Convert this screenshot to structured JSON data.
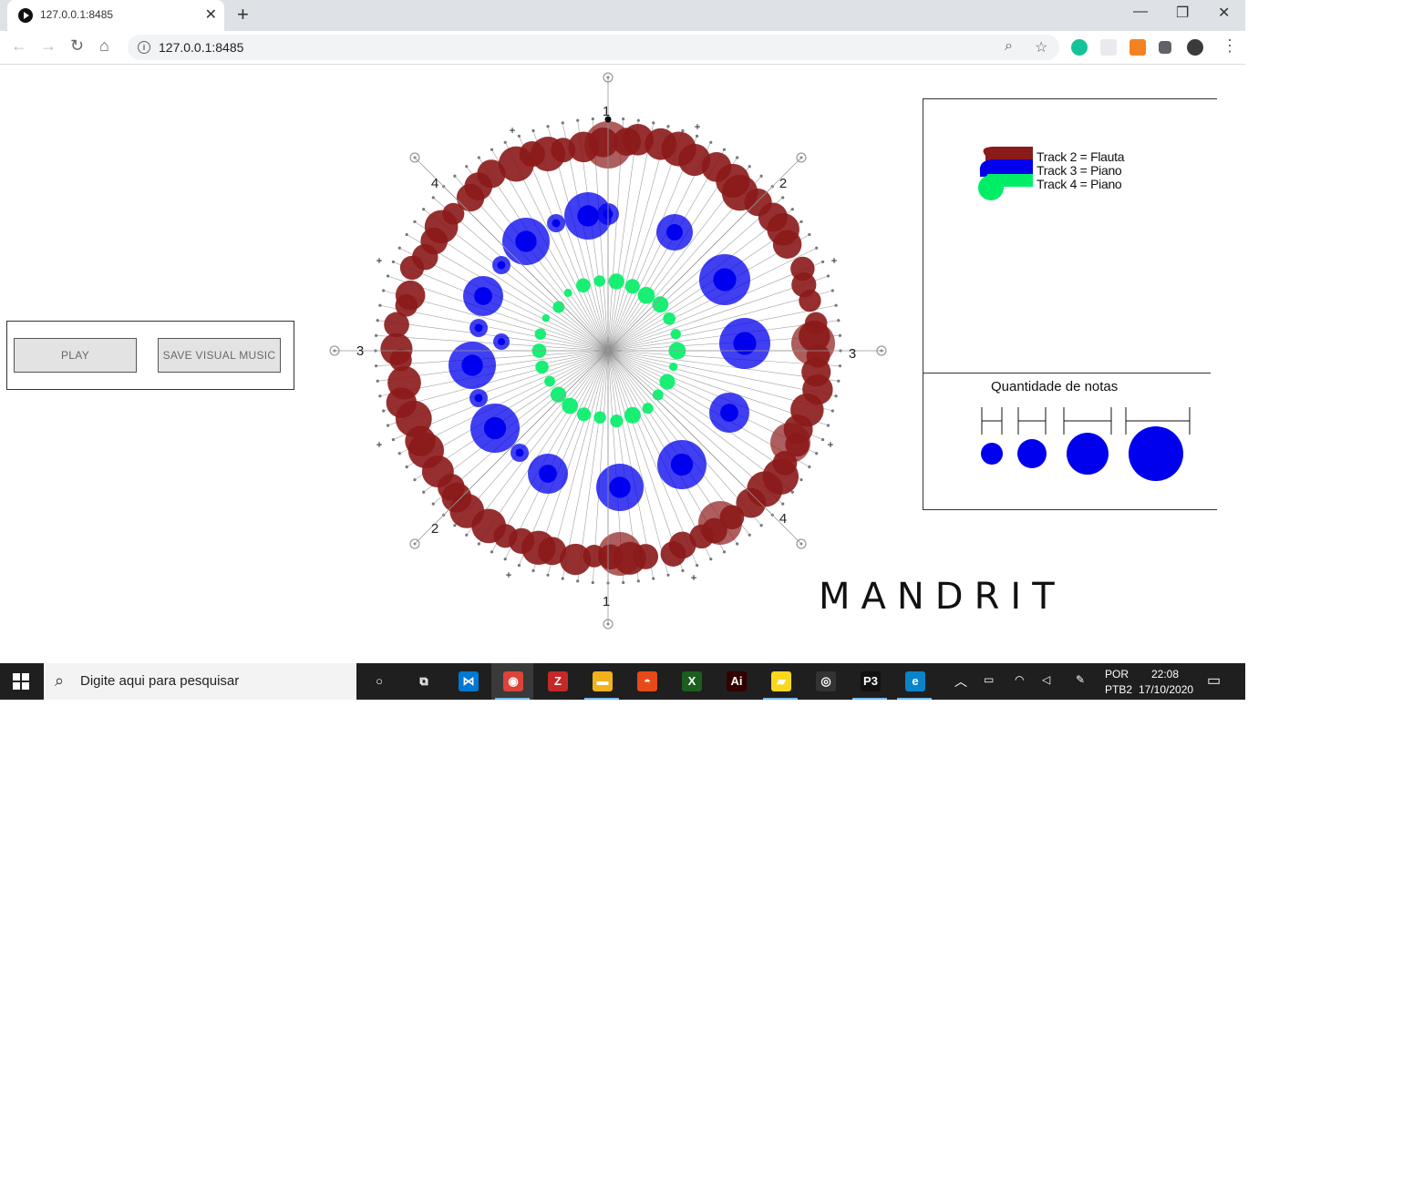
{
  "browser": {
    "tab_title": "127.0.0.1:8485",
    "url": "127.0.0.1:8485",
    "close_glyph": "✕",
    "new_tab_glyph": "+",
    "back_glyph": "←",
    "forward_glyph": "→",
    "reload_glyph": "↻",
    "home_glyph": "⌂",
    "zoom_glyph": "⌕",
    "star_glyph": "☆",
    "menu_glyph": "⋮",
    "minimize_glyph": "—",
    "restore_glyph": "❐",
    "close_window_glyph": "✕"
  },
  "app": {
    "play_label": "PLAY",
    "save_label": "SAVE VISUAL MUSIC",
    "brand": "MANDRIT",
    "legend": {
      "tracks": [
        {
          "label": "Track 2 = Flauta",
          "color": "#8b1a1a"
        },
        {
          "label": "Track 3 = Piano",
          "color": "#0000ee"
        },
        {
          "label": "Track 4 = Piano",
          "color": "#00ee66"
        }
      ],
      "quantity_title": "Quantidade de notas",
      "size_color": "#0000ee"
    },
    "mandala": {
      "axis_labels": {
        "top": "1",
        "bottom": "1",
        "left": "3",
        "right": "3",
        "upper_left": "4",
        "upper_right": "2",
        "lower_left": "2",
        "lower_right": "4"
      },
      "plus_glyph": "+",
      "colors": {
        "outer": "#8b1a1a",
        "middle": "#0000ee",
        "inner": "#00ee66",
        "lines": "#888888"
      }
    }
  },
  "taskbar": {
    "search_placeholder": "Digite aqui para pesquisar",
    "apps": [
      {
        "name": "cortana",
        "glyph": "○"
      },
      {
        "name": "task-view",
        "glyph": "⧉"
      },
      {
        "name": "vscode",
        "glyph": "⋈"
      },
      {
        "name": "chrome",
        "glyph": "◉"
      },
      {
        "name": "zotero",
        "glyph": "Z"
      },
      {
        "name": "file-explorer",
        "glyph": "▬"
      },
      {
        "name": "vpn",
        "glyph": "◓"
      },
      {
        "name": "xming",
        "glyph": "X"
      },
      {
        "name": "illustrator",
        "glyph": "Ai"
      },
      {
        "name": "sticky-notes",
        "glyph": "▰"
      },
      {
        "name": "obs",
        "glyph": "◎"
      },
      {
        "name": "processing",
        "glyph": "P3"
      },
      {
        "name": "edge",
        "glyph": "e"
      }
    ],
    "lang_top": "POR",
    "lang_bottom": "PTB2",
    "time": "22:08",
    "date": "17/10/2020"
  }
}
